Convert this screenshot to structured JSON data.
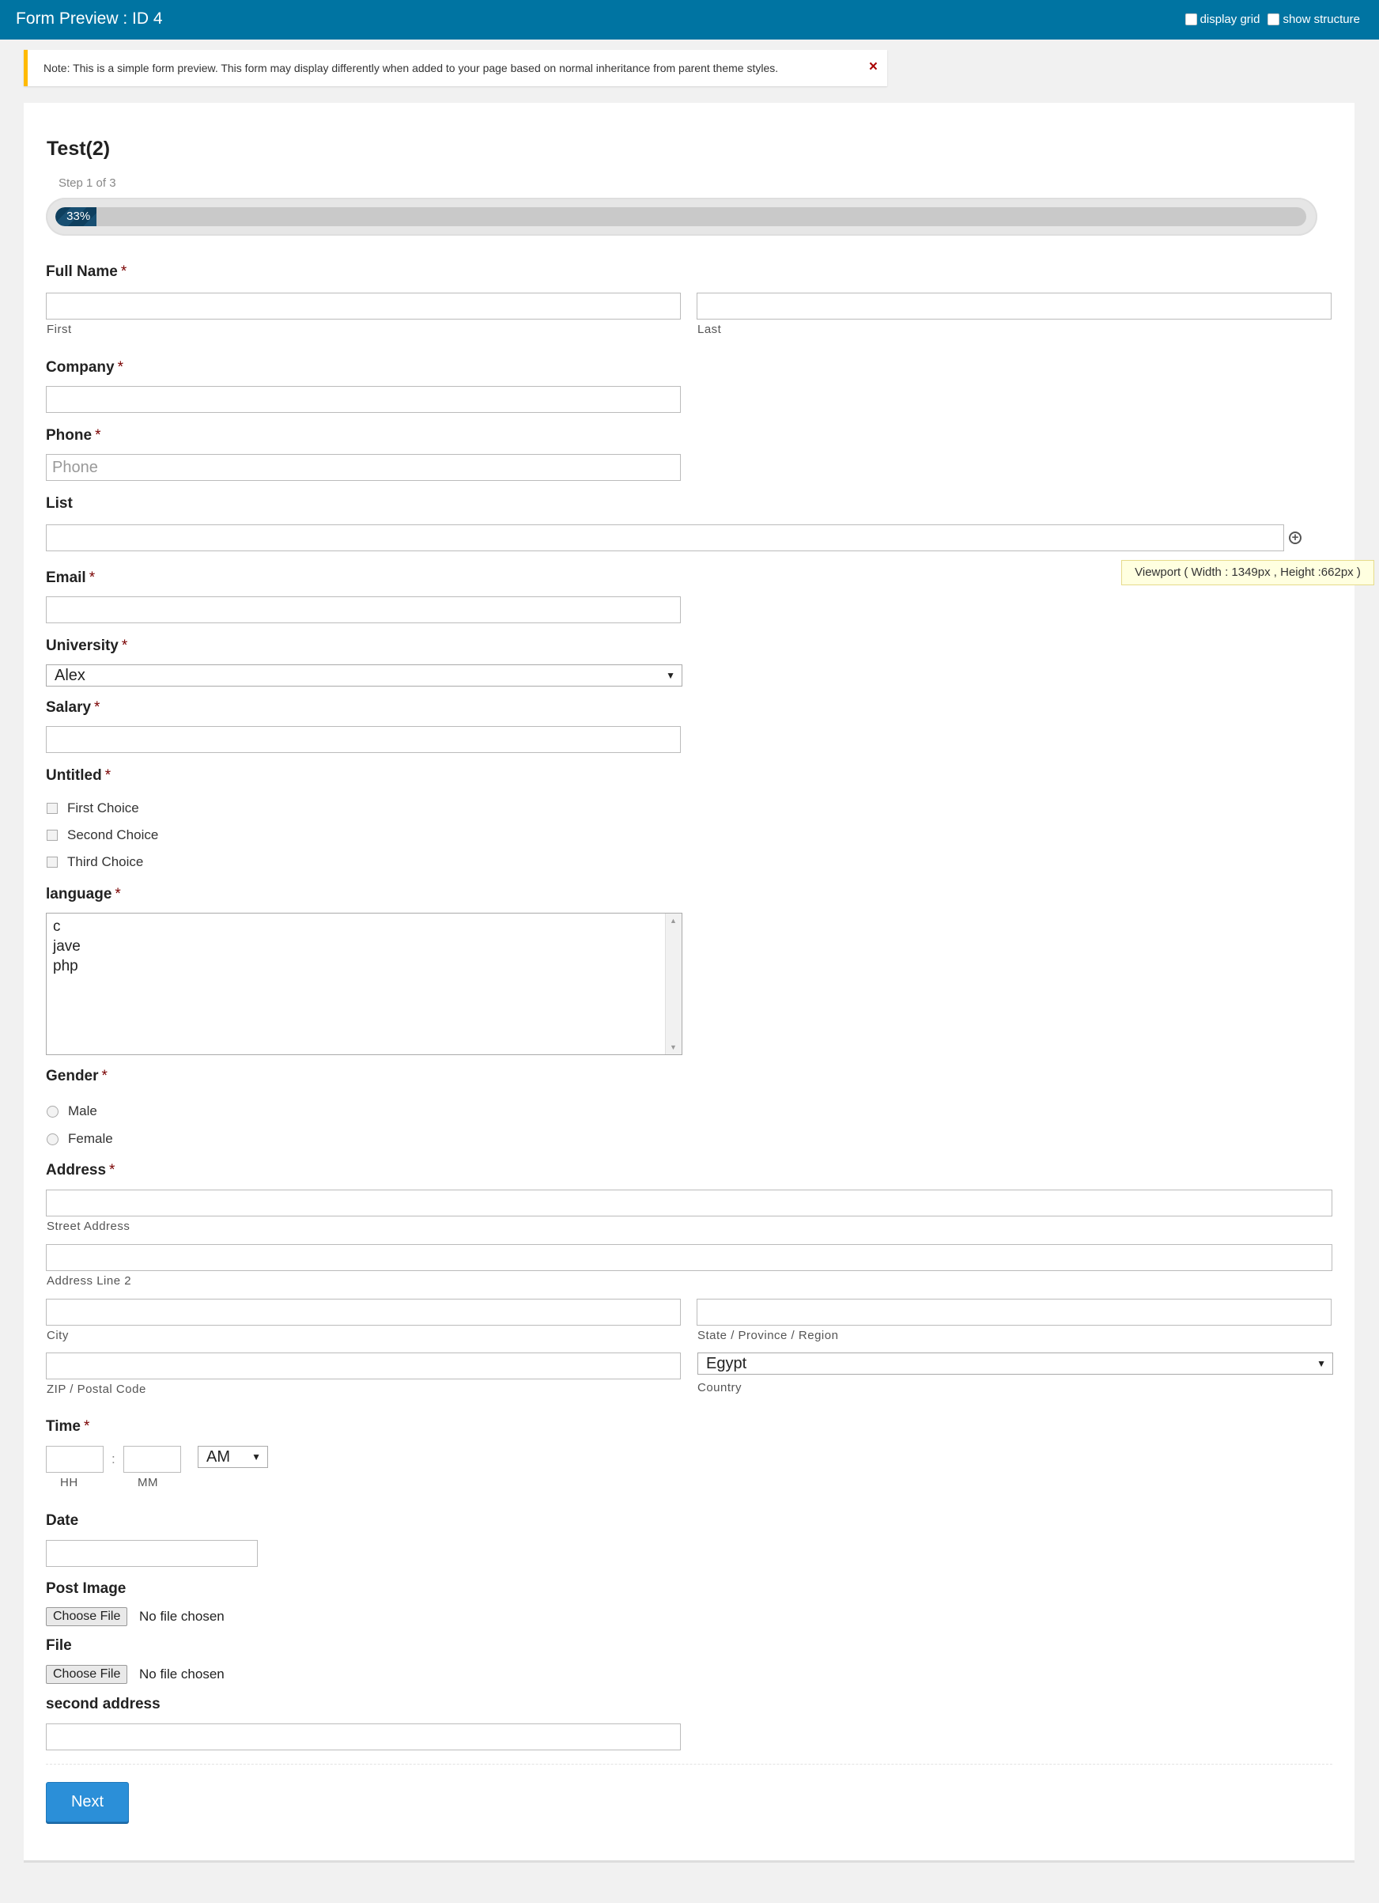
{
  "topbar": {
    "title": "Form Preview : ID 4",
    "display_grid": "display grid",
    "show_structure": "show structure"
  },
  "notice": {
    "text": "Note: This is a simple form preview. This form may display differently when added to your page based on normal inheritance from parent theme styles.",
    "close": "×"
  },
  "form": {
    "title": "Test(2)",
    "step": "Step 1 of 3",
    "progress": {
      "percent": 33,
      "label": "33%"
    },
    "full_name": {
      "label": "Full Name",
      "req": "*",
      "first": "First",
      "last": "Last"
    },
    "company": {
      "label": "Company",
      "req": "*"
    },
    "phone": {
      "label": "Phone",
      "req": "*",
      "placeholder": "Phone"
    },
    "list": {
      "label": "List"
    },
    "email": {
      "label": "Email",
      "req": "*"
    },
    "university": {
      "label": "University",
      "req": "*",
      "value": "Alex",
      "arrow": "▼"
    },
    "salary": {
      "label": "Salary",
      "req": "*"
    },
    "untitled": {
      "label": "Untitled",
      "req": "*",
      "choices": [
        "First Choice",
        "Second Choice",
        "Third Choice"
      ]
    },
    "language": {
      "label": "language",
      "req": "*",
      "options": [
        "c",
        "jave",
        "php"
      ],
      "scroll_up": "▲",
      "scroll_down": "▼"
    },
    "gender": {
      "label": "Gender",
      "req": "*",
      "options": [
        "Male",
        "Female"
      ]
    },
    "address": {
      "label": "Address",
      "req": "*",
      "street": "Street Address",
      "line2": "Address Line 2",
      "city": "City",
      "state": "State / Province / Region",
      "zip": "ZIP / Postal Code",
      "country_label": "Country",
      "country_value": "Egypt",
      "arrow": "▼"
    },
    "time": {
      "label": "Time",
      "req": "*",
      "hh": "HH",
      "mm": "MM",
      "separator": ":",
      "ampm": "AM",
      "arrow": "▼"
    },
    "date": {
      "label": "Date"
    },
    "post_image": {
      "label": "Post Image",
      "button": "Choose File",
      "status": "No file chosen"
    },
    "file": {
      "label": "File",
      "button": "Choose File",
      "status": "No file chosen"
    },
    "second_address": {
      "label": "second address"
    },
    "next": "Next"
  },
  "tooltip": "Viewport ( Width : 1349px , Height :662px )",
  "colors": {
    "topbar": "#0074a2",
    "accent": "#2b8fd8",
    "required": "#790000",
    "notice_border": "#ffba00"
  }
}
